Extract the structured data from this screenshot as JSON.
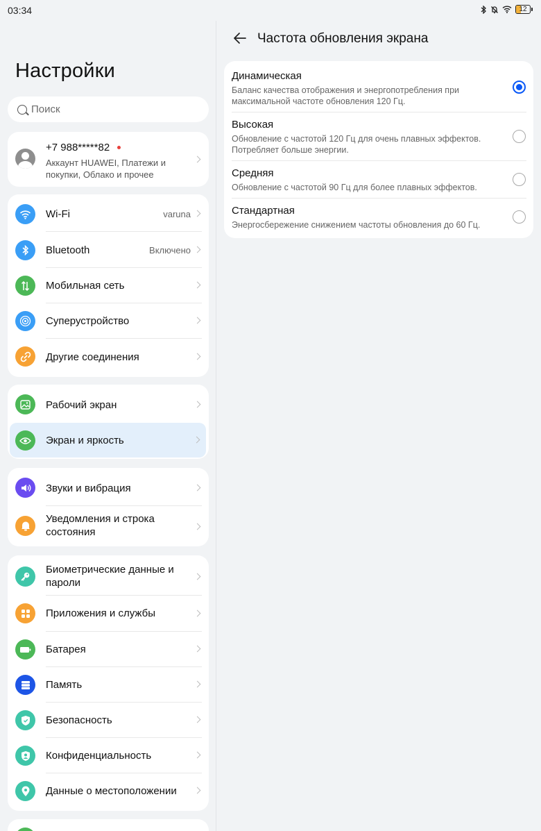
{
  "status_bar": {
    "time": "03:34",
    "battery_level": "12",
    "battery_fraction": 0.12
  },
  "left": {
    "title": "Настройки",
    "search_placeholder": "Поиск",
    "account": {
      "phone": "+7 988*****82",
      "desc": "Аккаунт HUAWEI, Платежи и покупки, Облако и прочее"
    },
    "group1": [
      {
        "label": "Wi-Fi",
        "value": "varuna",
        "icon": "wifi-icon",
        "color": "#3a9ef6"
      },
      {
        "label": "Bluetooth",
        "value": "Включено",
        "icon": "bluetooth-icon",
        "color": "#3a9ef6"
      },
      {
        "label": "Мобильная сеть",
        "value": "",
        "icon": "mobile-data-icon",
        "color": "#4cb857"
      },
      {
        "label": "Суперустройство",
        "value": "",
        "icon": "superdevice-icon",
        "color": "#3a9ef6"
      },
      {
        "label": "Другие соединения",
        "value": "",
        "icon": "link-icon",
        "color": "#f7a234"
      }
    ],
    "group2": [
      {
        "label": "Рабочий экран",
        "icon": "home-screen-icon",
        "color": "#4cb857"
      },
      {
        "label": "Экран и яркость",
        "icon": "eye-icon",
        "color": "#4cb857"
      }
    ],
    "group3": [
      {
        "label": "Звуки и вибрация",
        "icon": "sound-icon",
        "color": "#6a4cf0"
      },
      {
        "label": "Уведомления и строка состояния",
        "icon": "bell-icon",
        "color": "#f7a234"
      }
    ],
    "group4": [
      {
        "label": "Биометрические данные и пароли",
        "icon": "key-icon",
        "color": "#3fc6a9"
      },
      {
        "label": "Приложения и службы",
        "icon": "apps-icon",
        "color": "#f7a234"
      },
      {
        "label": "Батарея",
        "icon": "battery-icon",
        "color": "#4cb857"
      },
      {
        "label": "Память",
        "icon": "storage-icon",
        "color": "#1d55e6"
      },
      {
        "label": "Безопасность",
        "icon": "shield-icon",
        "color": "#3fc6a9"
      },
      {
        "label": "Конфиденциальность",
        "icon": "privacy-icon",
        "color": "#3fc6a9"
      },
      {
        "label": "Данные о местоположении",
        "icon": "location-icon",
        "color": "#3fc6a9"
      }
    ]
  },
  "right": {
    "title": "Частота обновления экрана",
    "options": [
      {
        "title": "Динамическая",
        "desc": "Баланс качества отображения и энергопотребления при максимальной частоте обновления 120 Гц.",
        "selected": true
      },
      {
        "title": "Высокая",
        "desc": "Обновление с частотой 120 Гц для очень плавных эффектов. Потребляет больше энергии.",
        "selected": false
      },
      {
        "title": "Средняя",
        "desc": "Обновление с частотой 90 Гц для более плавных эффектов.",
        "selected": false
      },
      {
        "title": "Стандартная",
        "desc": "Энергосбережение снижением частоты обновления до 60 Гц.",
        "selected": false
      }
    ]
  },
  "colors": {
    "accent": "#0a59f7",
    "selected_row_bg": "#e3effb",
    "notification_dot": "#e8403c"
  }
}
